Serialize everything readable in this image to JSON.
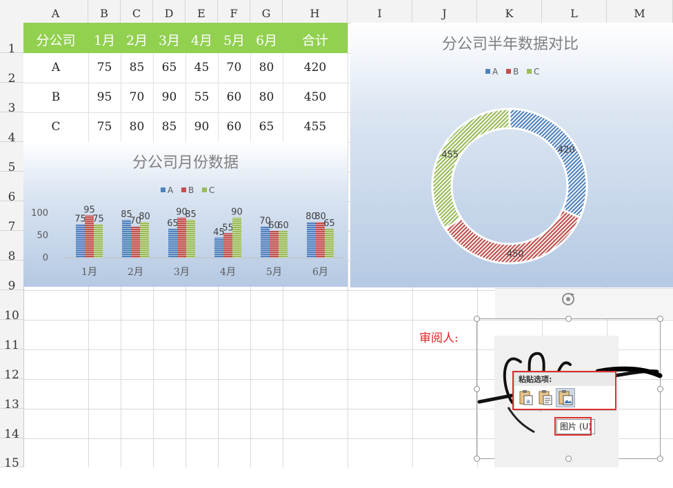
{
  "columns": [
    "A",
    "B",
    "C",
    "D",
    "E",
    "F",
    "G",
    "H",
    "I",
    "J",
    "K",
    "L",
    "M"
  ],
  "rows": [
    "1",
    "2",
    "3",
    "4",
    "5",
    "6",
    "7",
    "8",
    "9",
    "10",
    "11",
    "12",
    "13",
    "14",
    "15"
  ],
  "table": {
    "headers": [
      "分公司",
      "1月",
      "2月",
      "3月",
      "4月",
      "5月",
      "6月",
      "合计"
    ],
    "rows": [
      [
        "A",
        "75",
        "85",
        "65",
        "45",
        "70",
        "80",
        "420"
      ],
      [
        "B",
        "95",
        "70",
        "90",
        "55",
        "60",
        "80",
        "450"
      ],
      [
        "C",
        "75",
        "80",
        "85",
        "90",
        "60",
        "65",
        "455"
      ]
    ],
    "header_color": "#92d050"
  },
  "reviewer_label": "审阅人:",
  "paste_options": {
    "title": "粘贴选项:",
    "buttons": [
      "paste-keep-formatting-icon",
      "paste-formulas-icon",
      "paste-picture-icon"
    ],
    "tooltip": "图片 (U)"
  },
  "colors": {
    "A": "#4f81bd",
    "B": "#c0504d",
    "C": "#9bbb59"
  },
  "chart_data": [
    {
      "type": "bar",
      "title": "分公司月份数据",
      "categories": [
        "1月",
        "2月",
        "3月",
        "4月",
        "5月",
        "6月"
      ],
      "series": [
        {
          "name": "A",
          "values": [
            75,
            85,
            65,
            45,
            70,
            80
          ]
        },
        {
          "name": "B",
          "values": [
            95,
            70,
            90,
            55,
            60,
            80
          ]
        },
        {
          "name": "C",
          "values": [
            75,
            80,
            85,
            90,
            60,
            65
          ]
        }
      ],
      "y_ticks": [
        "100",
        "50",
        "0"
      ],
      "ylim": [
        0,
        100
      ],
      "legend": "top"
    },
    {
      "type": "pie",
      "title": "分公司半年数据对比",
      "labels": [
        "A",
        "B",
        "C"
      ],
      "values": [
        420,
        450,
        455
      ],
      "donut": true,
      "legend": "top"
    }
  ]
}
